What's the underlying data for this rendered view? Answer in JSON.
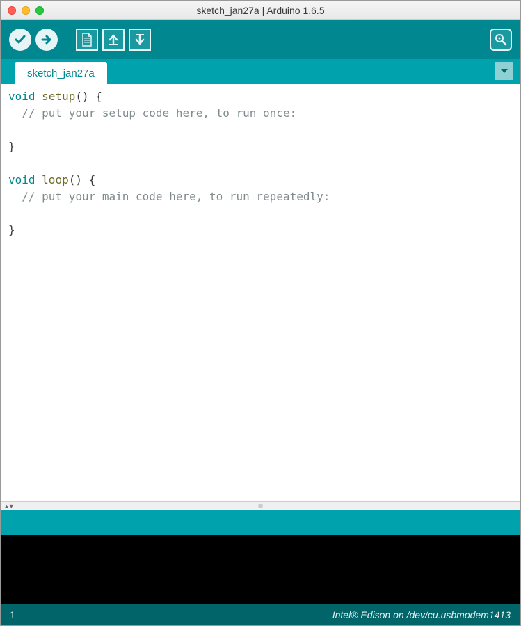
{
  "window": {
    "title": "sketch_jan27a | Arduino 1.6.5"
  },
  "toolbar": {
    "verify": "verify",
    "upload": "upload",
    "newfile": "new",
    "open": "open",
    "save": "save",
    "serial_monitor": "serial-monitor"
  },
  "tabs": {
    "active": "sketch_jan27a"
  },
  "code": {
    "tokens": [
      {
        "t": "type",
        "v": "void "
      },
      {
        "t": "func",
        "v": "setup"
      },
      {
        "t": "",
        "v": "() {\n"
      },
      {
        "t": "comment",
        "v": "  // put your setup code here, to run once:\n"
      },
      {
        "t": "",
        "v": "\n}\n\n"
      },
      {
        "t": "type",
        "v": "void "
      },
      {
        "t": "func",
        "v": "loop"
      },
      {
        "t": "",
        "v": "() {\n"
      },
      {
        "t": "comment",
        "v": "  // put your main code here, to run repeatedly:\n"
      },
      {
        "t": "",
        "v": "\n}\n"
      }
    ]
  },
  "footer": {
    "line_number": "1",
    "board_port": "Intel® Edison on /dev/cu.usbmodem1413"
  }
}
